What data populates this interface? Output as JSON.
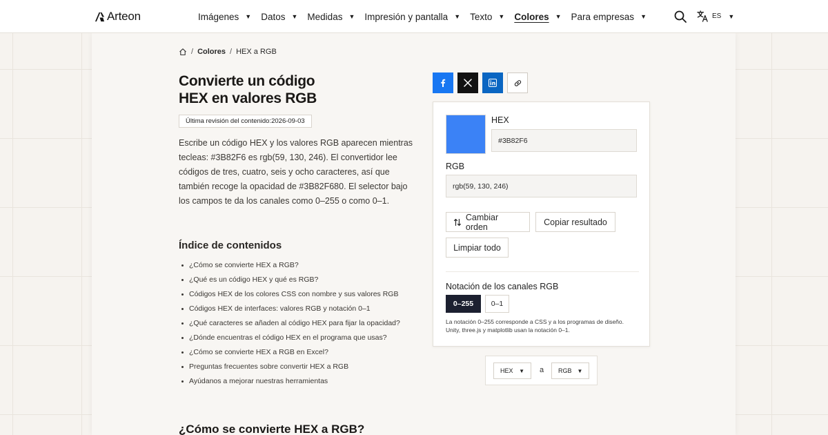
{
  "brand": {
    "name": "Arteon"
  },
  "nav": {
    "items": [
      {
        "label": "Imágenes",
        "active": false
      },
      {
        "label": "Datos",
        "active": false
      },
      {
        "label": "Medidas",
        "active": false
      },
      {
        "label": "Impresión y pantalla",
        "active": false
      },
      {
        "label": "Texto",
        "active": false
      },
      {
        "label": "Colores",
        "active": true
      },
      {
        "label": "Para empresas",
        "active": false
      }
    ],
    "language": "ES"
  },
  "breadcrumb": {
    "section": "Colores",
    "current": "HEX a RGB"
  },
  "page": {
    "title_line1": "Convierte un código",
    "title_line2": "HEX en valores RGB",
    "revision": "Última revisión del contenido:2026-09-03",
    "intro": "Escribe un código HEX y los valores RGB aparecen mientras tecleas: #3B82F6 es rgb(59, 130, 246). El convertidor lee códigos de tres, cuatro, seis y ocho caracteres, así que también recoge la opacidad de #3B82F680. El selector bajo los campos te da los canales como 0–255 o como 0–1."
  },
  "toc": {
    "title": "Índice de contenidos",
    "items": [
      "¿Cómo se convierte HEX a RGB?",
      "¿Qué es un código HEX y qué es RGB?",
      "Códigos HEX de los colores CSS con nombre y sus valores RGB",
      "Códigos HEX de interfaces: valores RGB y notación 0–1",
      "¿Qué caracteres se añaden al código HEX para fijar la opacidad?",
      "¿Dónde encuentras el código HEX en el programa que usas?",
      "¿Cómo se convierte HEX a RGB en Excel?",
      "Preguntas frecuentes sobre convertir HEX a RGB",
      "Ayúdanos a mejorar nuestras herramientas"
    ]
  },
  "section": {
    "heading": "¿Cómo se convierte HEX a RGB?"
  },
  "converter": {
    "swatch_color": "#3B82F6",
    "hex_label": "HEX",
    "hex_value": "#3B82F6",
    "rgb_label": "RGB",
    "rgb_value": "rgb(59, 130, 246)",
    "swap_label": "Cambiar orden",
    "copy_label": "Copiar resultado",
    "clear_label": "Limpiar todo",
    "notation_title": "Notación de los canales RGB",
    "notation_options": [
      "0–255",
      "0–1"
    ],
    "notation_selected": "0–255",
    "note": "La notación 0–255 corresponde a CSS y a los programas de diseño. Unity, three.js y matplotlib usan la notación 0–1."
  },
  "units": {
    "from": "HEX",
    "to": "RGB",
    "separator": "a"
  },
  "colors": {
    "accent_dark": "#1c2030",
    "facebook": "#1877f2",
    "x": "#121212",
    "linkedin": "#0a66c2"
  },
  "icons": [
    "home-icon",
    "search-icon",
    "translate-icon",
    "facebook-icon",
    "x-icon",
    "linkedin-icon",
    "link-icon",
    "swap-icon"
  ]
}
